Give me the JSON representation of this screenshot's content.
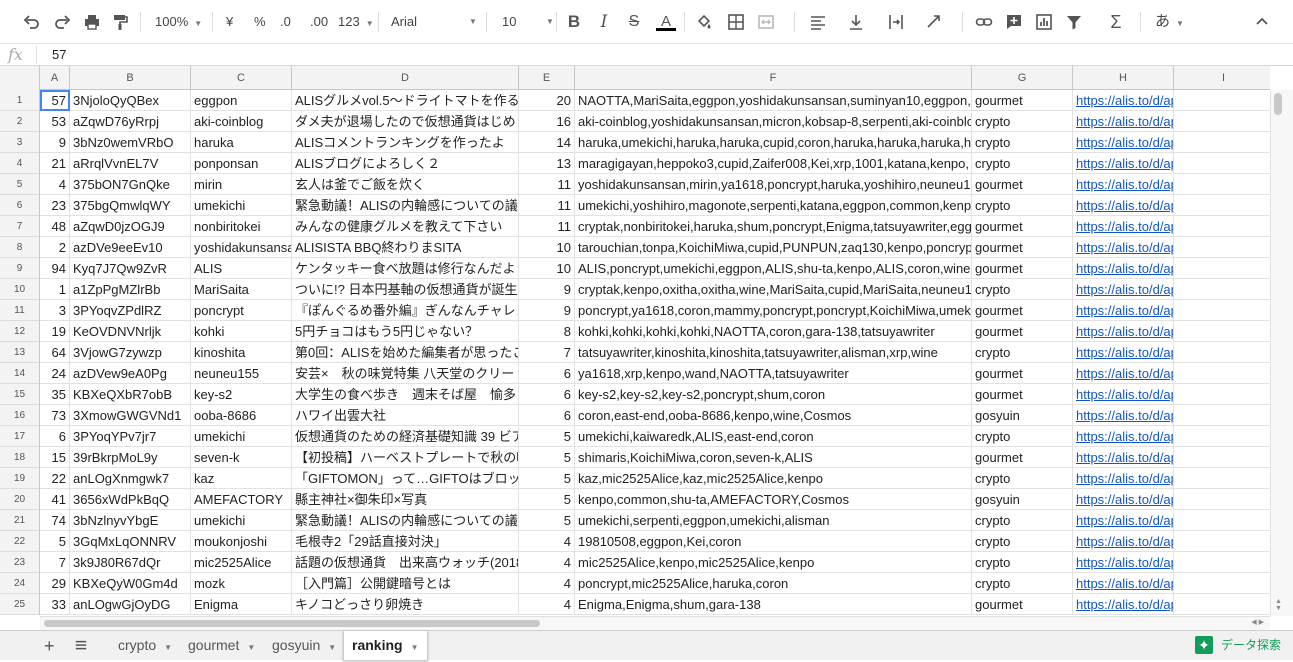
{
  "toolbar": {
    "zoom": "100%",
    "currency": "¥",
    "percent": "%",
    "dec_decrease": ".0",
    "dec_increase": ".00",
    "more_formats": "123",
    "font": "Arial",
    "font_size": "10",
    "input_tools": "あ"
  },
  "formula_bar": {
    "fx": "fx",
    "value": "57"
  },
  "columns": [
    "A",
    "B",
    "C",
    "D",
    "E",
    "F",
    "G",
    "H",
    "I"
  ],
  "rows": [
    [
      "1",
      "57",
      "3NjoloQyQBex",
      "eggpon",
      "ALISグルメvol.5〜ドライトマトを作る",
      "20",
      "NAOTTA,MariSaita,eggpon,yoshidakunsansan,suminyan10,eggpon,",
      "gourmet",
      "https://alis.to/d/api/articles_image"
    ],
    [
      "2",
      "53",
      "aZqwD76yRrpj",
      "aki-coinblog",
      "ダメ夫が退場したので仮想通貨はじめ",
      "16",
      "aki-coinblog,yoshidakunsansan,micron,kobsap-8,serpenti,aki-coinblo",
      "crypto",
      "https://alis.to/d/api/articles_image"
    ],
    [
      "3",
      "9",
      "3bNz0wemVRbO",
      "haruka",
      "ALISコメントランキングを作ったよ",
      "14",
      "haruka,umekichi,haruka,haruka,cupid,coron,haruka,haruka,haruka,h",
      "crypto",
      "https://alis.to/d/api/articles_image"
    ],
    [
      "4",
      "21",
      "aRrqlVvnEL7V",
      "ponponsan",
      "ALISブログによろしく２",
      "13",
      "maragigayan,heppoko3,cupid,Zaifer008,Kei,xrp,1001,katana,kenpo,",
      "crypto",
      "https://alis.to/d/api/articles_image"
    ],
    [
      "5",
      "4",
      "375bON7GnQke",
      "mirin",
      "玄人は釜でご飯を炊く",
      "11",
      "yoshidakunsansan,mirin,ya1618,poncrypt,haruka,yoshihiro,neuneu1",
      "gourmet",
      "https://alis.to/d/api/articles_image"
    ],
    [
      "6",
      "23",
      "375bgQmwlqWY",
      "umekichi",
      "緊急動議！ALISの内輪感についての議",
      "11",
      "umekichi,yoshihiro,magonote,serpenti,katana,eggpon,common,kenp",
      "crypto",
      "https://alis.to/d/api/articles_image"
    ],
    [
      "7",
      "48",
      "aZqwD0jzOGJ9",
      "nonbiritokei",
      "みんなの健康グルメを教えて下さい",
      "11",
      "cryptak,nonbiritokei,haruka,shum,poncrypt,Enigma,tatsuyawriter,egg",
      "gourmet",
      "https://alis.to/d/api/articles_image"
    ],
    [
      "8",
      "2",
      "azDVe9eeEv10",
      "yoshidakunsansan",
      "ALISISTA BBQ終わりまSITA",
      "10",
      "tarouchian,tonpa,KoichiMiwa,cupid,PUNPUN,zaq130,kenpo,poncryp",
      "gourmet",
      "https://alis.to/d/api/articles_image"
    ],
    [
      "9",
      "94",
      "Kyq7J7Qw9ZvR",
      "ALIS",
      "ケンタッキー食べ放題は修行なんだよ",
      "10",
      "ALIS,poncrypt,umekichi,eggpon,ALIS,shu-ta,kenpo,ALIS,coron,wine",
      "gourmet",
      "https://alis.to/d/api/articles_image"
    ],
    [
      "10",
      "1",
      "a1ZpPgMZlrBb",
      "MariSaita",
      "ついに!? 日本円基軸の仮想通貨が誕生",
      "9",
      "cryptak,kenpo,oxitha,oxitha,wine,MariSaita,cupid,MariSaita,neuneu1",
      "crypto",
      "https://alis.to/d/api/articles_image"
    ],
    [
      "11",
      "3",
      "3PYoqvZPdlRZ",
      "poncrypt",
      "『ぽんぐるめ番外編』ぎんなんチャレン",
      "9",
      "poncrypt,ya1618,coron,mammy,poncrypt,poncrypt,KoichiMiwa,umek",
      "gourmet",
      "https://alis.to/d/api/articles_image"
    ],
    [
      "12",
      "19",
      "KeOVDNVNrljk",
      "kohki",
      "5円チョコはもう5円じゃない？",
      "8",
      "kohki,kohki,kohki,kohki,NAOTTA,coron,gara-138,tatsuyawriter",
      "gourmet",
      "https://alis.to/d/api/articles_image"
    ],
    [
      "13",
      "64",
      "3VjowG7zywzp",
      "kinoshita",
      "第0回：ALISを始めた編集者が思ったこ",
      "7",
      "tatsuyawriter,kinoshita,kinoshita,tatsuyawriter,alisman,xrp,wine",
      "crypto",
      "https://alis.to/d/api/articles_image"
    ],
    [
      "14",
      "24",
      "azDVew9eA0Pg",
      "neuneu155",
      "安芸×　秋の味覚特集 八天堂のクリー",
      "6",
      "ya1618,xrp,kenpo,wand,NAOTTA,tatsuyawriter",
      "gourmet",
      "https://alis.to/d/api/articles_image"
    ],
    [
      "15",
      "35",
      "KBXeQXbR7obB",
      "key-s2",
      "大学生の食べ歩き　週末そば屋　愉多",
      "6",
      "key-s2,key-s2,key-s2,poncrypt,shum,coron",
      "gourmet",
      "https://alis.to/d/api/articles_image"
    ],
    [
      "16",
      "73",
      "3XmowGWGVNd1",
      "ooba-8686",
      "ハワイ出雲大社",
      "6",
      "coron,east-end,ooba-8686,kenpo,wine,Cosmos",
      "gosyuin",
      "https://alis.to/d/api/articles_image"
    ],
    [
      "17",
      "6",
      "3PYoqYPv7jr7",
      "umekichi",
      "仮想通貨のための経済基礎知識 39 ビア",
      "5",
      "umekichi,kaiwaredk,ALIS,east-end,coron",
      "crypto",
      "https://alis.to/d/api/articles_image"
    ],
    [
      "18",
      "15",
      "39rBkrpMoL9y",
      "seven-k",
      "【初投稿】ハーベストプレートで秋の味",
      "5",
      "shimaris,KoichiMiwa,coron,seven-k,ALIS",
      "gourmet",
      "https://alis.to/d/api/articles_image"
    ],
    [
      "19",
      "22",
      "anLOgXnmgwk7",
      "kaz",
      "「GIFTOMON」って…GIFTOはブロック",
      "5",
      "kaz,mic2525Alice,kaz,mic2525Alice,kenpo",
      "crypto",
      "https://alis.to/d/api/articles_image"
    ],
    [
      "20",
      "41",
      "3656xWdPkBqQ",
      "AMEFACTORY",
      "縣主神社×御朱印×写真",
      "5",
      "kenpo,common,shu-ta,AMEFACTORY,Cosmos",
      "gosyuin",
      "https://alis.to/d/api/articles_image"
    ],
    [
      "21",
      "74",
      "3bNzlnyvYbgE",
      "umekichi",
      "緊急動議！ALISの内輪感についての議",
      "5",
      "umekichi,serpenti,eggpon,umekichi,alisman",
      "crypto",
      "https://alis.to/d/api/articles_image"
    ],
    [
      "22",
      "5",
      "3GqMxLqONNRV",
      "moukonjoshi",
      "毛根寺2「29話直接対決」",
      "4",
      "19810508,eggpon,Kei,coron",
      "crypto",
      "https://alis.to/d/api/articles_image"
    ],
    [
      "23",
      "7",
      "3k9J80R67dQr",
      "mic2525Alice",
      "話題の仮想通貨　出来高ウォッチ(2018",
      "4",
      "mic2525Alice,kenpo,mic2525Alice,kenpo",
      "crypto",
      "https://alis.to/d/api/articles_image"
    ],
    [
      "24",
      "29",
      "KBXeQyW0Gm4d",
      "mozk",
      "［入門篇］公開鍵暗号とは",
      "4",
      "poncrypt,mic2525Alice,haruka,coron",
      "crypto",
      "https://alis.to/d/api/articles_image"
    ],
    [
      "25",
      "33",
      "anLOgwGjOyDG",
      "Enigma",
      "キノコどっさり卵焼き",
      "4",
      "Enigma,Enigma,shum,gara-138",
      "gourmet",
      "https://alis.to/d/api/articles_image"
    ]
  ],
  "sheet_tabs": [
    "crypto",
    "gourmet",
    "gosyuin",
    "ranking"
  ],
  "active_tab": "ranking",
  "explore_label": "データ探索",
  "colors": {
    "link": "#1155cc",
    "selection": "#4285f4",
    "explore": "#0f9d58"
  }
}
